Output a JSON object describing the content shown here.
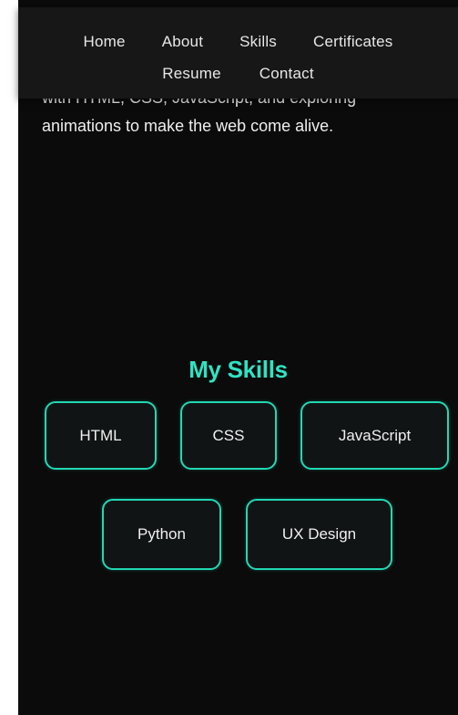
{
  "nav": {
    "row1": [
      "Home",
      "About",
      "Skills",
      "Certificates"
    ],
    "row2": [
      "Resume",
      "Contact"
    ]
  },
  "intro": {
    "line1": "with HTML, CSS, JavaScript, and exploring",
    "line2": "animations to make the web come alive."
  },
  "skills": {
    "title": "My Skills",
    "items": [
      "HTML",
      "CSS",
      "JavaScript",
      "Python",
      "UX Design"
    ]
  },
  "colors": {
    "background": "#0b0b0b",
    "navbar": "#171717",
    "accent": "#21d8b4",
    "title": "#2fe3c2"
  }
}
